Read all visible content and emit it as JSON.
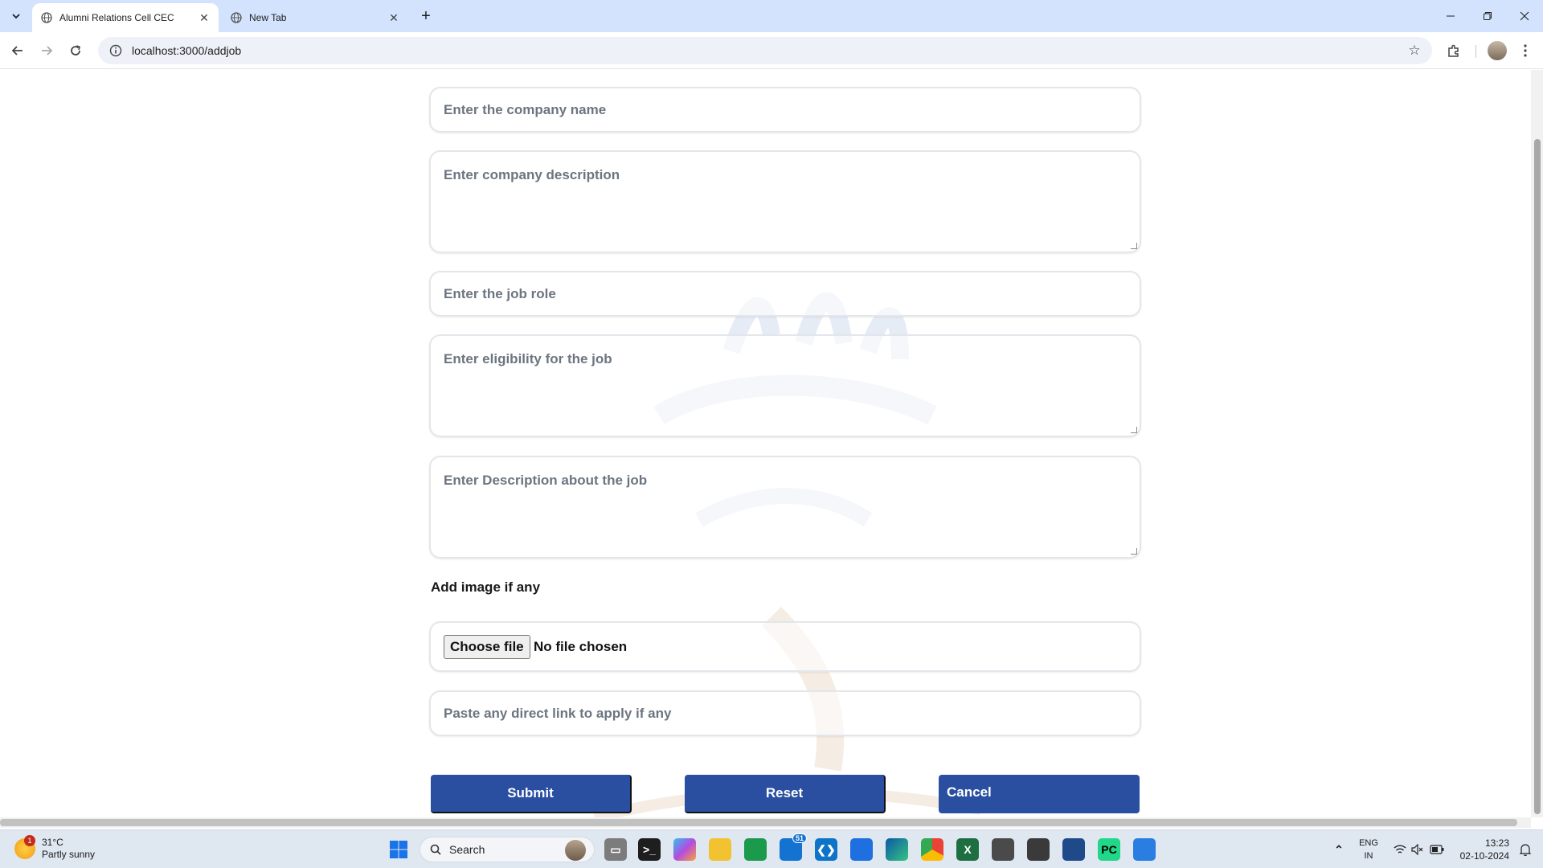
{
  "browser": {
    "tabs": [
      {
        "title": "Alumni Relations Cell CEC",
        "active": true
      },
      {
        "title": "New Tab",
        "active": false
      }
    ],
    "url": "localhost:3000/addjob"
  },
  "form": {
    "company_name_placeholder": "Enter the company name",
    "company_description_placeholder": "Enter company description",
    "job_role_placeholder": "Enter the job role",
    "eligibility_placeholder": "Enter eligibility for the job",
    "job_description_placeholder": "Enter Description about the job",
    "image_label": "Add image if any",
    "file_button_label": "Choose file",
    "file_status": "No file chosen",
    "apply_link_placeholder": "Paste any direct link to apply if any",
    "submit_label": "Submit",
    "reset_label": "Reset",
    "cancel_label": "Cancel"
  },
  "taskbar": {
    "weather_temp": "31°C",
    "weather_desc": "Partly sunny",
    "weather_badge": "1",
    "search_label": "Search",
    "mail_badge": "51",
    "lang_line1": "ENG",
    "lang_line2": "IN",
    "time": "13:23",
    "date": "02-10-2024"
  },
  "colors": {
    "button_blue": "#2a4fa0",
    "tabstrip": "#d3e3fd",
    "taskbar": "#dfe7f1"
  }
}
